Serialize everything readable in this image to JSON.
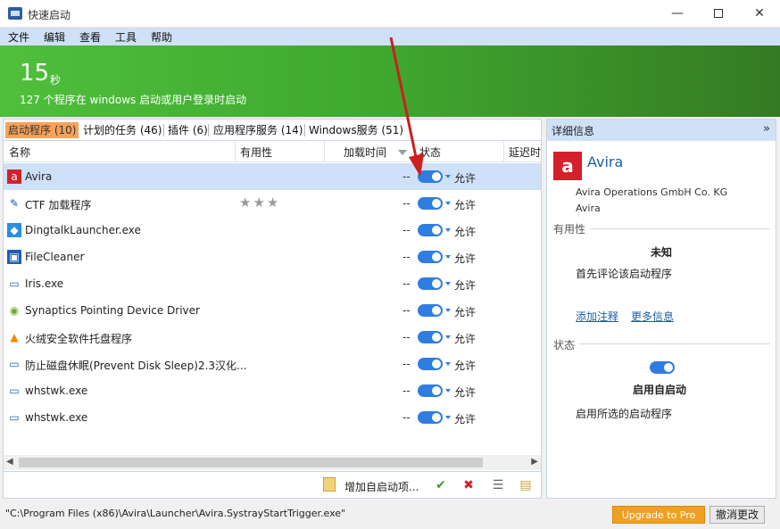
{
  "window": {
    "title": "快速启动",
    "minimize": "—",
    "close": "✕"
  },
  "menu": [
    "文件",
    "编辑",
    "查看",
    "工具",
    "帮助"
  ],
  "banner": {
    "time_value": "15",
    "time_unit": "秒",
    "description": "127 个程序在 windows 启动或用户登录时启动"
  },
  "tabs": [
    {
      "label": "启动程序 (10)",
      "active": true
    },
    {
      "label": "计划的任务 (46)",
      "active": false
    },
    {
      "label": "插件 (6)",
      "active": false
    },
    {
      "label": "应用程序服务 (14)",
      "active": false
    },
    {
      "label": "Windows服务 (51)",
      "active": false
    }
  ],
  "table": {
    "columns": [
      "名称",
      "有用性",
      "加载时间",
      "状态",
      "延迟时"
    ],
    "rows": [
      {
        "name": "Avira",
        "icon": "avira-icon",
        "stars": "",
        "load_time": "--",
        "status": "允许",
        "selected": true
      },
      {
        "name": "CTF 加载程序",
        "icon": "pen-icon",
        "stars": "★★★",
        "load_time": "--",
        "status": "允许",
        "selected": false
      },
      {
        "name": "DingtalkLauncher.exe",
        "icon": "dingtalk-icon",
        "stars": "",
        "load_time": "--",
        "status": "允许",
        "selected": false
      },
      {
        "name": "FileCleaner",
        "icon": "filecleaner-icon",
        "stars": "",
        "load_time": "--",
        "status": "允许",
        "selected": false
      },
      {
        "name": "Iris.exe",
        "icon": "window-icon",
        "stars": "",
        "load_time": "--",
        "status": "允许",
        "selected": false
      },
      {
        "name": "Synaptics Pointing Device Driver",
        "icon": "synaptics-icon",
        "stars": "",
        "load_time": "--",
        "status": "允许",
        "selected": false
      },
      {
        "name": "火绒安全软件托盘程序",
        "icon": "huorong-icon",
        "stars": "",
        "load_time": "--",
        "status": "允许",
        "selected": false
      },
      {
        "name": "防止磁盘休眠(Prevent Disk Sleep)2.3汉化...",
        "icon": "window-icon",
        "stars": "",
        "load_time": "--",
        "status": "允许",
        "selected": false
      },
      {
        "name": "whstwk.exe",
        "icon": "window-icon",
        "stars": "",
        "load_time": "--",
        "status": "允许",
        "selected": false
      },
      {
        "name": "whstwk.exe",
        "icon": "window-icon",
        "stars": "",
        "load_time": "--",
        "status": "允许",
        "selected": false
      }
    ]
  },
  "toolbar": {
    "add_label": "增加自启动项..."
  },
  "detail": {
    "header": "详细信息",
    "name": "Avira",
    "logo_letter": "a",
    "company": "Avira Operations GmbH  Co. KG",
    "product": "Avira",
    "usefulness_label": "有用性",
    "usefulness_value": "未知",
    "usefulness_hint": "首先评论该启动程序",
    "add_note_link": "添加注释",
    "more_info_link": "更多信息",
    "status_label": "状态",
    "status_value": "启用自启动",
    "status_desc": "启用所选的启动程序"
  },
  "statusbar": {
    "path": "\"C:\\Program Files (x86)\\Avira\\Launcher\\Avira.SystrayStartTrigger.exe\"",
    "upgrade_label": "Upgrade to Pro",
    "undo_label": "撤消更改"
  },
  "colors": {
    "accent": "#2f7de1",
    "banner_green": "#3fa72e",
    "active_tab": "#f5a25a",
    "upgrade": "#f0a020",
    "annotation_arrow": "#cc1f1f"
  }
}
